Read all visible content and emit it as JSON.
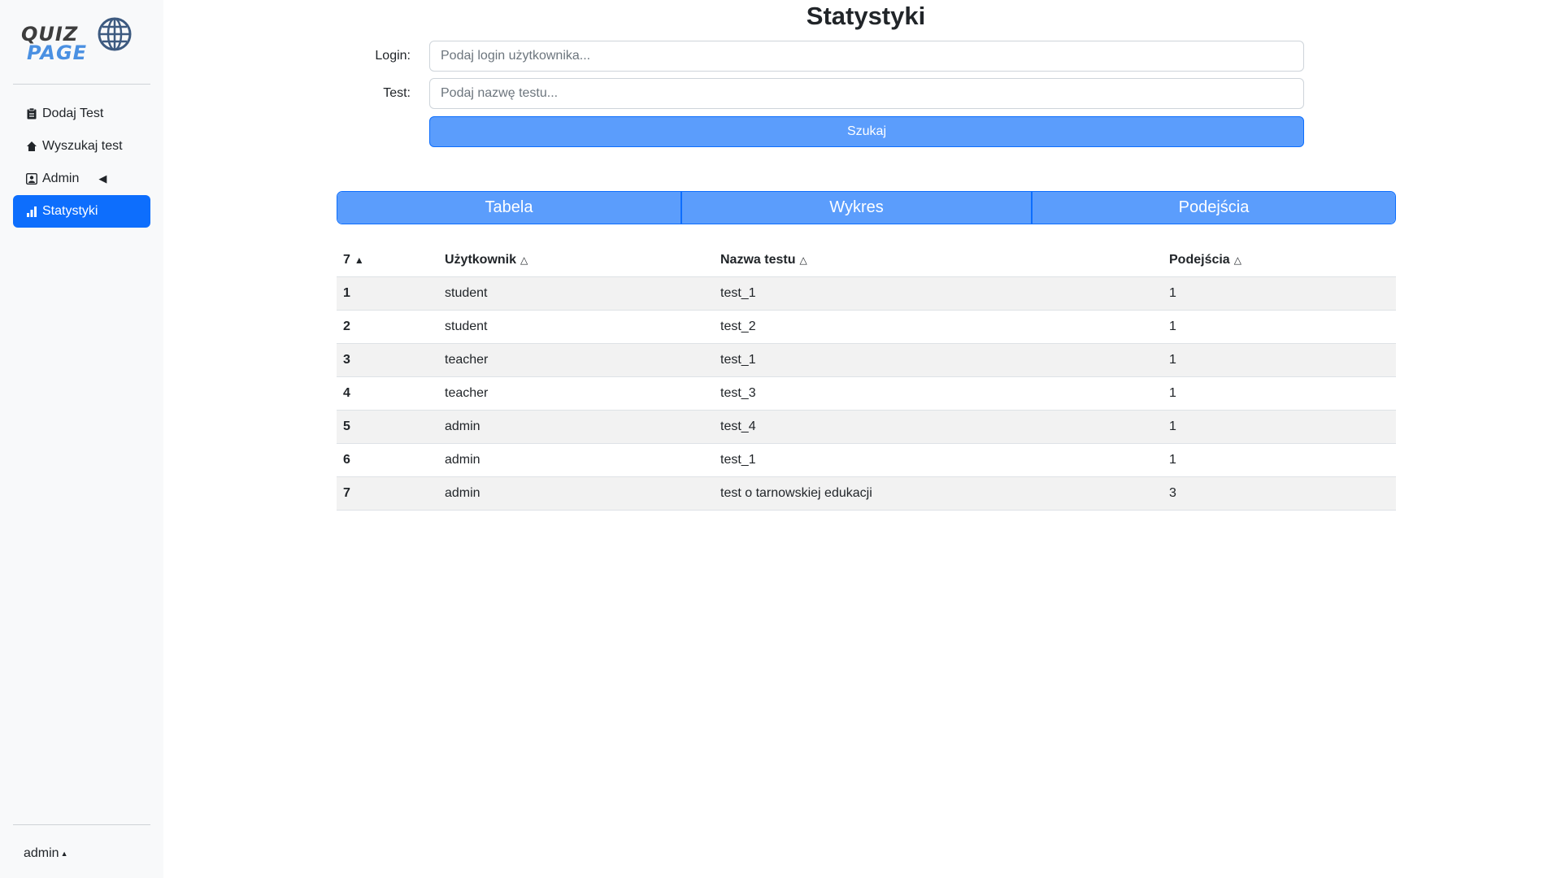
{
  "sidebar": {
    "logo": {
      "line1": "QUIZ",
      "line2": "PAGE"
    },
    "items": [
      {
        "label": "Dodaj Test",
        "icon": "clipboard-icon"
      },
      {
        "label": "Wyszukaj test",
        "icon": "home-icon"
      },
      {
        "label": "Admin",
        "icon": "person-badge-icon",
        "caret": "◀"
      },
      {
        "label": "Statystyki",
        "icon": "bar-chart-icon",
        "active": true
      }
    ],
    "user": {
      "name": "admin",
      "caret": "▲"
    }
  },
  "page": {
    "title": "Statystyki"
  },
  "form": {
    "login_label": "Login:",
    "login_placeholder": "Podaj login użytkownika...",
    "test_label": "Test:",
    "test_placeholder": "Podaj nazwę testu...",
    "search_label": "Szukaj"
  },
  "tabs": [
    {
      "label": "Tabela"
    },
    {
      "label": "Wykres"
    },
    {
      "label": "Podejścia"
    }
  ],
  "table": {
    "headers": [
      {
        "label": "7",
        "sort": "▲"
      },
      {
        "label": "Użytkownik",
        "sort": "△"
      },
      {
        "label": "Nazwa testu",
        "sort": "△"
      },
      {
        "label": "Podejścia",
        "sort": "△"
      }
    ],
    "rows": [
      [
        "1",
        "student",
        "test_1",
        "1"
      ],
      [
        "2",
        "student",
        "test_2",
        "1"
      ],
      [
        "3",
        "teacher",
        "test_1",
        "1"
      ],
      [
        "4",
        "teacher",
        "test_3",
        "1"
      ],
      [
        "5",
        "admin",
        "test_4",
        "1"
      ],
      [
        "6",
        "admin",
        "test_1",
        "1"
      ],
      [
        "7",
        "admin",
        "test o tarnowskiej edukacji",
        "3"
      ]
    ]
  },
  "colors": {
    "accent": "#0d6efd",
    "button_fill": "#5b9dfc",
    "sidebar_bg": "#f8f9fa",
    "row_stripe": "#f2f2f2"
  }
}
